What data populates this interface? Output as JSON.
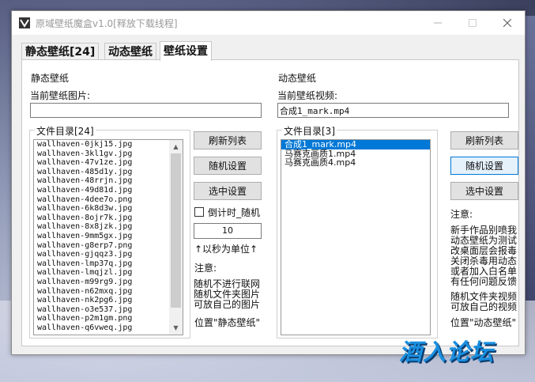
{
  "window": {
    "title": "原域壁纸魔盒v1.0[释放下载线程]"
  },
  "tabs": [
    {
      "label": "静态壁纸[24]"
    },
    {
      "label": "动态壁纸"
    },
    {
      "label": "壁纸设置"
    }
  ],
  "static": {
    "group_title": "静态壁纸",
    "current_label": "当前壁纸图片:",
    "current_value": "",
    "dir_title": "文件目录[24]",
    "files": [
      "wallhaven-0jkj15.jpg",
      "wallhaven-3kl1gv.jpg",
      "wallhaven-47v1ze.jpg",
      "wallhaven-485d1y.jpg",
      "wallhaven-48rrjn.jpg",
      "wallhaven-49d81d.jpg",
      "wallhaven-4dee7o.png",
      "wallhaven-6k8d3w.jpg",
      "wallhaven-8ojr7k.jpg",
      "wallhaven-8x8jzk.jpg",
      "wallhaven-9mm5gx.jpg",
      "wallhaven-g8erp7.png",
      "wallhaven-gjqqz3.jpg",
      "wallhaven-lmp37q.jpg",
      "wallhaven-lmqjzl.jpg",
      "wallhaven-m99rg9.jpg",
      "wallhaven-n62mxq.jpg",
      "wallhaven-nk2pg6.jpg",
      "wallhaven-o3e537.jpg",
      "wallhaven-p2m1gm.png",
      "wallhaven-q6vweq.jpg"
    ],
    "refresh_label": "刷新列表",
    "random_label": "随机设置",
    "select_label": "选中设置",
    "timer_label": "倒计时_随机",
    "timer_value": "10",
    "unit_label": "↑以秒为单位↑",
    "note_title": "注意:",
    "note_text": "随机不进行联网\n随机文件夹图片\n可放自己的图片",
    "location_text": "位置\"静态壁纸\""
  },
  "dynamic": {
    "group_title": "动态壁纸",
    "current_label": "当前壁纸视频:",
    "current_value": "合成1_mark.mp4",
    "dir_title": "文件目录[3]",
    "files": [
      "合成1_mark.mp4",
      "马赛克画质1.mp4",
      "马赛克画质4.mp4"
    ],
    "selected_index": 0,
    "refresh_label": "刷新列表",
    "random_label": "随机设置",
    "select_label": "选中设置",
    "note_title": "注意:",
    "note_text": "新手作品别喷我\n动态壁纸为测试\n改桌面层会报毒\n关闭杀毒用动态\n或者加入白名单\n有任何问题反馈",
    "note_text2": "随机文件夹视频\n可放自己的视频",
    "location_text": "位置\"动态壁纸\""
  },
  "watermark": "酒入论坛",
  "colors": {
    "accent": "#0078d7",
    "watermark": "#1a8fe0"
  }
}
